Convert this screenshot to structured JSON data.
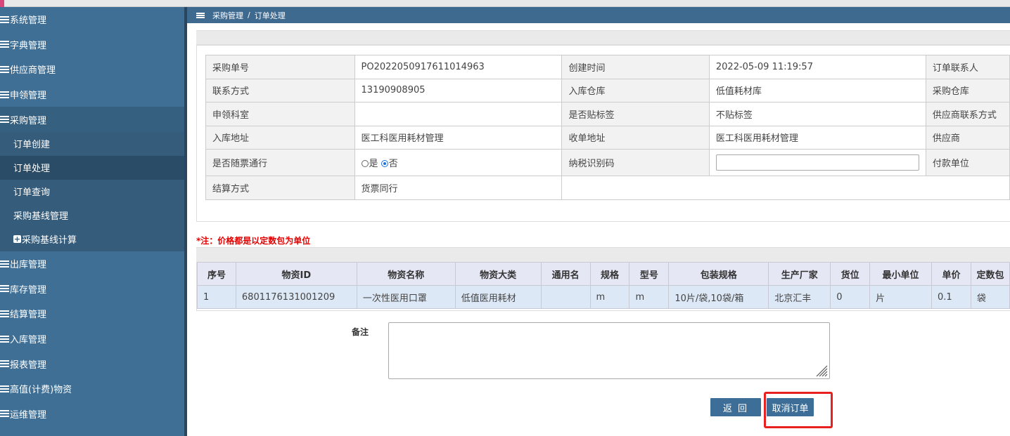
{
  "breadcrumb": {
    "parent": "采购管理",
    "separator": "/",
    "current": "订单处理"
  },
  "sidebar": {
    "items_top": [
      {
        "label": "系统管理"
      },
      {
        "label": "字典管理"
      },
      {
        "label": "供应商管理"
      },
      {
        "label": "申领管理"
      },
      {
        "label": "采购管理"
      }
    ],
    "sub_items": [
      {
        "label": "订单创建"
      },
      {
        "label": "订单处理"
      },
      {
        "label": "订单查询"
      },
      {
        "label": "采购基线管理"
      },
      {
        "label": "采购基线计算"
      }
    ],
    "items_bottom": [
      {
        "label": "出库管理"
      },
      {
        "label": "库存管理"
      },
      {
        "label": "结算管理"
      },
      {
        "label": "入库管理"
      },
      {
        "label": "报表管理"
      },
      {
        "label": "高值(计费)物资"
      },
      {
        "label": "运维管理"
      }
    ]
  },
  "order": {
    "po_label": "采购单号",
    "po_value": "PO2022050917611014963",
    "created_label": "创建时间",
    "created_value": "2022-05-09 11:19:57",
    "contact_label": "订单联系人",
    "phone_label": "联系方式",
    "phone_value": "13190908905",
    "in_wh_label": "入库仓库",
    "in_wh_value": "低值耗材库",
    "pur_wh_label": "采购仓库",
    "dept_label": "申领科室",
    "dept_value": "",
    "tag_label": "是否贴标签",
    "tag_value": "不贴标签",
    "sup_contact_label": "供应商联系方式",
    "in_addr_label": "入库地址",
    "in_addr_value": "医工科医用耗材管理",
    "recv_addr_label": "收单地址",
    "recv_addr_value": "医工科医用耗材管理",
    "supplier_label": "供应商",
    "invoice_label": "是否随票通行",
    "radio_yes": "是",
    "radio_no": "否",
    "tax_label": "纳税识别码",
    "payer_label": "付款单位",
    "settle_label": "结算方式",
    "settle_value": "货票同行"
  },
  "note": "*注：价格都是以定数包为单位",
  "items_table": {
    "headers": [
      "序号",
      "物资ID",
      "物资名称",
      "物资大类",
      "通用名",
      "规格",
      "型号",
      "包装规格",
      "生产厂家",
      "货位",
      "最小单位",
      "单价",
      "定数包"
    ],
    "rows": [
      [
        "1",
        "6801176131001209",
        "一次性医用口罩",
        "低值医用耗材",
        "",
        "m",
        "m",
        "10片/袋,10袋/箱",
        "北京汇丰",
        "0",
        "片",
        "0.1",
        "袋"
      ]
    ]
  },
  "remark_label": "备注",
  "buttons": {
    "back": "返 回",
    "cancel": "取消订单"
  },
  "colors": {
    "sidebar": "#3f6f95",
    "header": "#3f6a90",
    "button": "#3d6e98",
    "note": "#e30000",
    "highlight": "#e82020"
  }
}
